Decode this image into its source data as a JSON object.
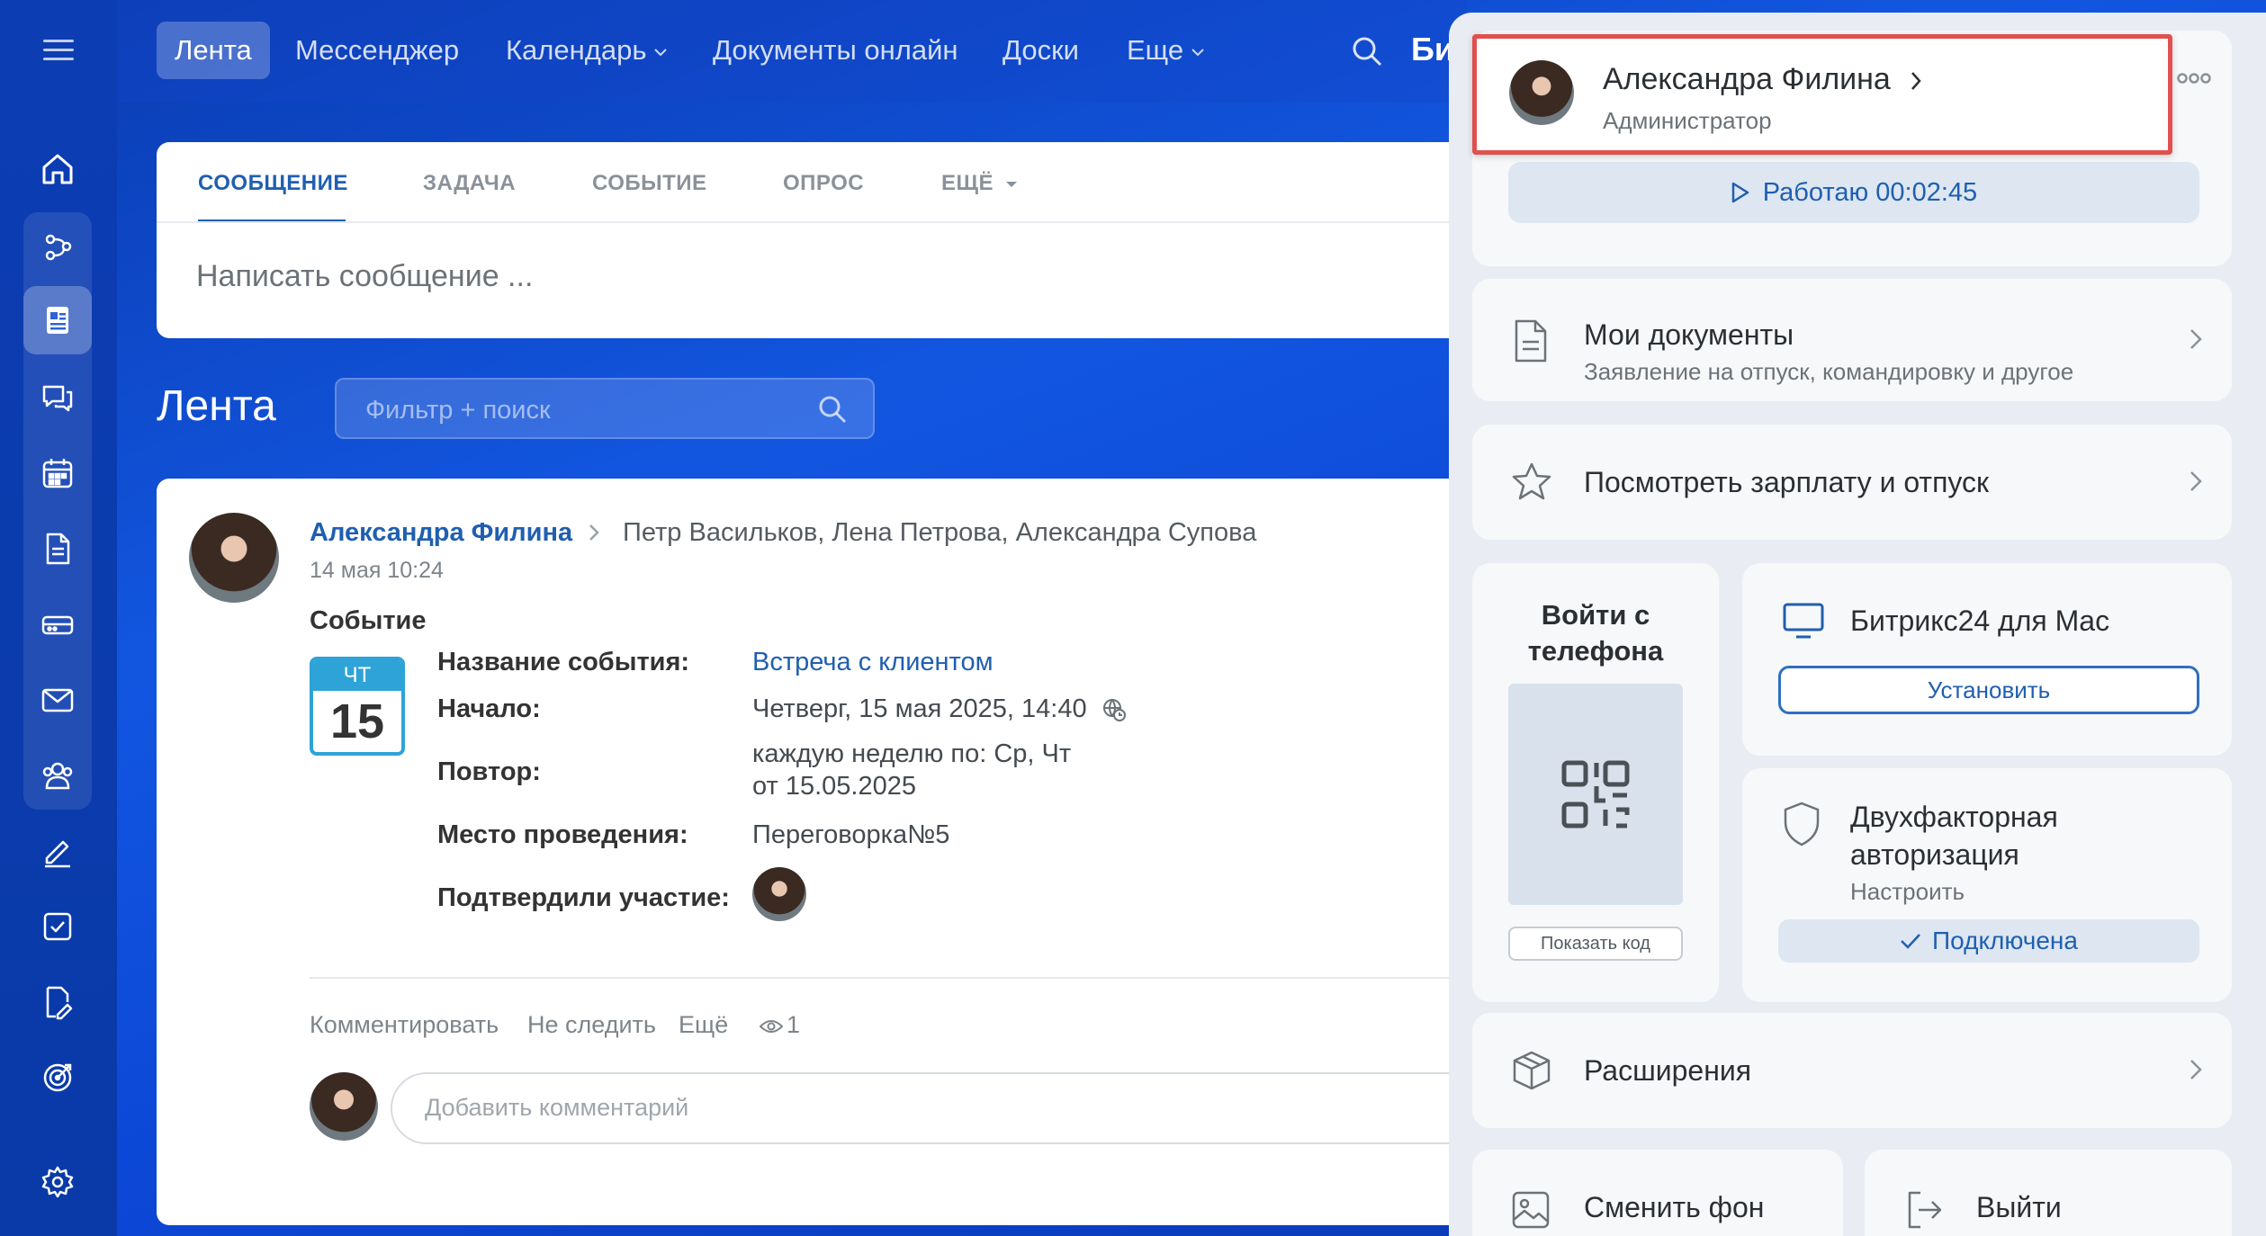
{
  "topnav": {
    "items": [
      {
        "label": "Лента",
        "active": true
      },
      {
        "label": "Мессенджер"
      },
      {
        "label": "Календарь",
        "dropdown": true
      },
      {
        "label": "Документы онлайн"
      },
      {
        "label": "Доски"
      },
      {
        "label": "Еще",
        "dropdown": true
      }
    ],
    "brand_crop": "Би"
  },
  "composer": {
    "tabs": [
      "СООБЩЕНИЕ",
      "ЗАДАЧА",
      "СОБЫТИЕ",
      "ОПРОС",
      "ЕЩЁ"
    ],
    "placeholder": "Написать сообщение ..."
  },
  "feed": {
    "title": "Лента",
    "filter_placeholder": "Фильтр + поиск"
  },
  "post": {
    "author": "Александра Филина",
    "recipients": "Петр Васильков, Лена Петрова, Александра Супова",
    "time": "14 мая 10:24",
    "kind": "Событие",
    "calendar": {
      "weekday": "ЧТ",
      "day": "15"
    },
    "fields": {
      "name_label": "Название события:",
      "name_value": "Встреча с клиентом",
      "start_label": "Начало:",
      "start_value": "Четверг, 15 мая 2025, 14:40",
      "repeat_label": "Повтор:",
      "repeat_line1": "каждую неделю по: Ср, Чт",
      "repeat_line2": "от 15.05.2025",
      "place_label": "Место проведения:",
      "place_value": "Переговорка№5",
      "confirmed_label": "Подтвердили участие:"
    },
    "actions": {
      "comment": "Комментировать",
      "unfollow": "Не следить",
      "more": "Ещё",
      "views": "1"
    },
    "comment_placeholder": "Добавить комментарий"
  },
  "panel": {
    "profile": {
      "name": "Александра Филина",
      "role": "Администратор"
    },
    "work_button": "Работаю 00:02:45",
    "documents": {
      "title": "Мои документы",
      "subtitle": "Заявление на отпуск, командировку и другое"
    },
    "salary": {
      "title": "Посмотреть зарплату и отпуск"
    },
    "phone_login": {
      "line1": "Войти с",
      "line2": "телефона",
      "show_code": "Показать код"
    },
    "mac_app": {
      "title": "Битрикс24 для Mac",
      "button": "Установить"
    },
    "two_factor": {
      "line1": "Двухфакторная",
      "line2": "авторизация",
      "subtitle": "Настроить",
      "status": "Подключена"
    },
    "extensions": {
      "title": "Расширения"
    },
    "change_bg": {
      "title": "Сменить фон"
    },
    "logout": {
      "title": "Выйти"
    }
  },
  "colors": {
    "accent": "#1f5fb0",
    "highlight_border": "#e0504f",
    "calendar_blue": "#2ea3d8",
    "background_blue": "#0c47d6"
  }
}
